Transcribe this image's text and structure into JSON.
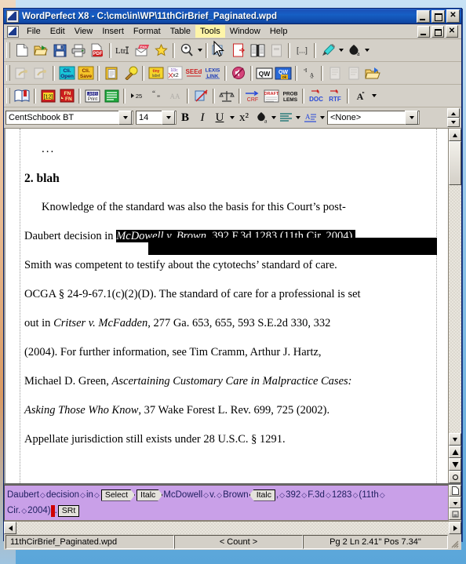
{
  "app": {
    "title": "WordPerfect X8 - C:\\cmc\\in\\WP\\11thCirBrief_Paginated.wpd",
    "icon": "wordperfect-icon"
  },
  "window_buttons": {
    "minimize": "_",
    "maximize": "□",
    "close": "✕"
  },
  "doc_window_buttons": {
    "minimize": "_",
    "restore": "❐",
    "close": "✕"
  },
  "menu": {
    "items": [
      {
        "label": "File",
        "mnemonic": "F",
        "active": false
      },
      {
        "label": "Edit",
        "mnemonic": "E",
        "active": false
      },
      {
        "label": "View",
        "mnemonic": "V",
        "active": false
      },
      {
        "label": "Insert",
        "mnemonic": "I",
        "active": false
      },
      {
        "label": "Format",
        "mnemonic": "o",
        "active": false
      },
      {
        "label": "Table",
        "mnemonic": "a",
        "active": false
      },
      {
        "label": "Tools",
        "mnemonic": "T",
        "active": true
      },
      {
        "label": "Window",
        "mnemonic": "W",
        "active": false
      },
      {
        "label": "Help",
        "mnemonic": "H",
        "active": false
      }
    ]
  },
  "toolbar1": {
    "buttons": [
      {
        "name": "new-document",
        "icon": "blank-page-icon"
      },
      {
        "name": "open-document",
        "icon": "open-folder-icon"
      },
      {
        "name": "save-document",
        "icon": "floppy-disk-icon"
      },
      {
        "name": "print-document",
        "icon": "printer-icon"
      },
      {
        "name": "publish-to-pdf",
        "icon": "pdf-icon"
      },
      {
        "name": "letter-format",
        "icon": "ltr-icon"
      },
      {
        "name": "envelope",
        "icon": "envelope-icon"
      },
      {
        "name": "favorites",
        "icon": "star-icon"
      },
      {
        "name": "zoom",
        "icon": "magnifier-zoom-icon"
      },
      {
        "name": "select-pointer",
        "icon": "arrow-pointer-icon"
      },
      {
        "name": "page-break",
        "icon": "page-break-icon"
      },
      {
        "name": "columns",
        "icon": "columns-icon"
      },
      {
        "name": "text-box",
        "icon": "text-box-icon"
      },
      {
        "name": "codes",
        "icon": "brackets-icon"
      },
      {
        "name": "highlighter",
        "icon": "highlighter-pen-icon"
      },
      {
        "name": "font-color",
        "icon": "paint-bucket-a-icon"
      }
    ]
  },
  "toolbar2": {
    "buttons": [
      {
        "name": "import-client",
        "icon": "client-import-icon"
      },
      {
        "name": "export-client",
        "icon": "client-export-icon"
      },
      {
        "name": "client-open",
        "icon": "cli-open-icon",
        "label": "Cli. Open"
      },
      {
        "name": "client-save",
        "icon": "cli-save-icon",
        "label": "Cli. Save"
      },
      {
        "name": "clipboard",
        "icon": "clipboard-icon"
      },
      {
        "name": "typeover",
        "icon": "type-icon"
      },
      {
        "name": "tiny-label",
        "icon": "tiny-label-icon"
      },
      {
        "name": "line-spacing-2",
        "icon": "spacing-1point2-icon"
      },
      {
        "name": "seed-search",
        "icon": "seed-icon",
        "label": "SEEd"
      },
      {
        "name": "lexis-link",
        "icon": "lexis-link-icon",
        "label": "LEXIS LINK"
      },
      {
        "name": "mute-sound",
        "icon": "sound-off-icon"
      },
      {
        "name": "quickwords",
        "icon": "qw-icon",
        "label": "QW"
      },
      {
        "name": "quickwords-ok",
        "icon": "qw-ok-icon",
        "label": "QW ok"
      },
      {
        "name": "sort-ascending",
        "icon": "sort-a-icon"
      },
      {
        "name": "page-left",
        "icon": "page-left-icon"
      },
      {
        "name": "page-right",
        "icon": "page-right-icon"
      },
      {
        "name": "open-export",
        "icon": "open-export-icon"
      }
    ]
  },
  "toolbar3": {
    "buttons": [
      {
        "name": "book-reference",
        "icon": "book-bookmark-icon"
      },
      {
        "name": "numbering",
        "icon": "bracket-12-icon",
        "label": "[12]"
      },
      {
        "name": "footnote-endnote",
        "icon": "fn-en-icon",
        "label": "FN EN"
      },
      {
        "name": "label-print",
        "icon": "label-print-icon",
        "label": "LABEL Print"
      },
      {
        "name": "green-lines",
        "icon": "green-lines-icon"
      },
      {
        "name": "goto-25",
        "icon": "goto-25-icon",
        "label": "25"
      },
      {
        "name": "quotes",
        "icon": "quote-marks-icon"
      },
      {
        "name": "small-caps",
        "icon": "double-a-icon"
      },
      {
        "name": "link-break",
        "icon": "link-break-icon"
      },
      {
        "name": "scales-of-justice",
        "icon": "scales-icon"
      },
      {
        "name": "crf",
        "icon": "crf-arrow-icon",
        "label": "CRF"
      },
      {
        "name": "draft",
        "icon": "draft-icon"
      },
      {
        "name": "problems",
        "icon": "problems-icon",
        "label": "PROB LEMS"
      },
      {
        "name": "save-as-doc",
        "icon": "doc-arrow-icon",
        "label": "DOC"
      },
      {
        "name": "save-as-rtf",
        "icon": "rtf-arrow-icon",
        "label": "RTF"
      },
      {
        "name": "macro",
        "icon": "macro-a-icon"
      }
    ]
  },
  "propertybar": {
    "font_name": "CentSchbook BT",
    "font_size": "14",
    "bold_label": "B",
    "italic_label": "I",
    "underline_label": "U",
    "superscript_label": "x²",
    "highlight_icon": "paint-bucket-a-icon",
    "justification_icon": "justify-icon",
    "style_icon": "style-a-icon",
    "style_value": "<None>"
  },
  "document": {
    "lines": [
      {
        "id": "l1",
        "type": "ellipsis",
        "text": "..."
      },
      {
        "id": "l2",
        "type": "heading",
        "text": "2. blah"
      },
      {
        "id": "l3",
        "type": "body",
        "text": "Knowledge of the standard was also the basis for this Court’s post-"
      },
      {
        "id": "l4",
        "type": "body-mixed",
        "pre": "Daubert decision in ",
        "sel_italic": "McDowell v. Brown",
        "sel_rest": ", 392 F.3d 1283 (11th Cir. 2004)."
      },
      {
        "id": "l5",
        "type": "body",
        "text": "Smith was competent to testify about the cytotechs’ standard of care."
      },
      {
        "id": "l6",
        "type": "body",
        "text": "OCGA § 24-9-67.1(c)(2)(D). The standard of care for a professional is set"
      },
      {
        "id": "l7",
        "type": "body-mixed2",
        "pre": "out in ",
        "italic": "Critser v. McFadden",
        "post": ", 277 Ga. 653, 655, 593 S.E.2d 330, 332"
      },
      {
        "id": "l8",
        "type": "body",
        "text": "(2004). For further information, see Tim Cramm, Arthur J. Hartz,"
      },
      {
        "id": "l9",
        "type": "body-mixed2",
        "pre": "Michael D. Green, ",
        "italic": "Ascertaining Customary Care in Malpractice Cases:",
        "post": ""
      },
      {
        "id": "l10",
        "type": "body-mixed3",
        "italic": "Asking Those Who Know",
        "post": ", 37 Wake Forest L. Rev. 699, 725 (2002)."
      },
      {
        "id": "l11",
        "type": "body",
        "text": "Appellate jurisdiction still exists under 28 U.S.C. § 1291."
      }
    ]
  },
  "reveal_codes": {
    "line1": [
      {
        "kind": "text",
        "text": "Daubert"
      },
      {
        "kind": "space"
      },
      {
        "kind": "text",
        "text": "decision"
      },
      {
        "kind": "space"
      },
      {
        "kind": "text",
        "text": "in"
      },
      {
        "kind": "space"
      },
      {
        "kind": "code-open",
        "text": "Select"
      },
      {
        "kind": "code-close",
        "text": "Italc"
      },
      {
        "kind": "text",
        "text": "McDowell"
      },
      {
        "kind": "space"
      },
      {
        "kind": "text",
        "text": "v."
      },
      {
        "kind": "space"
      },
      {
        "kind": "text",
        "text": "Brown"
      },
      {
        "kind": "code-close2",
        "text": "Italc"
      },
      {
        "kind": "text",
        "text": ","
      },
      {
        "kind": "space"
      },
      {
        "kind": "text",
        "text": "392"
      },
      {
        "kind": "space"
      },
      {
        "kind": "text",
        "text": "F.3d"
      },
      {
        "kind": "space"
      },
      {
        "kind": "text",
        "text": "1283"
      },
      {
        "kind": "space"
      },
      {
        "kind": "text",
        "text": "(11th"
      },
      {
        "kind": "space"
      }
    ],
    "line2": [
      {
        "kind": "text",
        "text": "Cir."
      },
      {
        "kind": "space"
      },
      {
        "kind": "text",
        "text": "2004)"
      },
      {
        "kind": "cursor"
      },
      {
        "kind": "text",
        "text": "."
      },
      {
        "kind": "code-plain",
        "text": "SRt"
      }
    ]
  },
  "statusbar": {
    "document_name": "11thCirBrief_Paginated.wpd",
    "count": "< Count >",
    "position": "Pg 2 Ln 2.41\" Pos 7.34\""
  },
  "colors": {
    "title_blue": "#1048a6",
    "chrome": "#d4d0c8",
    "reveal_codes_bg": "#c9a0e8",
    "menu_highlight": "#fdf4a8",
    "selection": "#000000",
    "cursor_red": "#d00000"
  }
}
